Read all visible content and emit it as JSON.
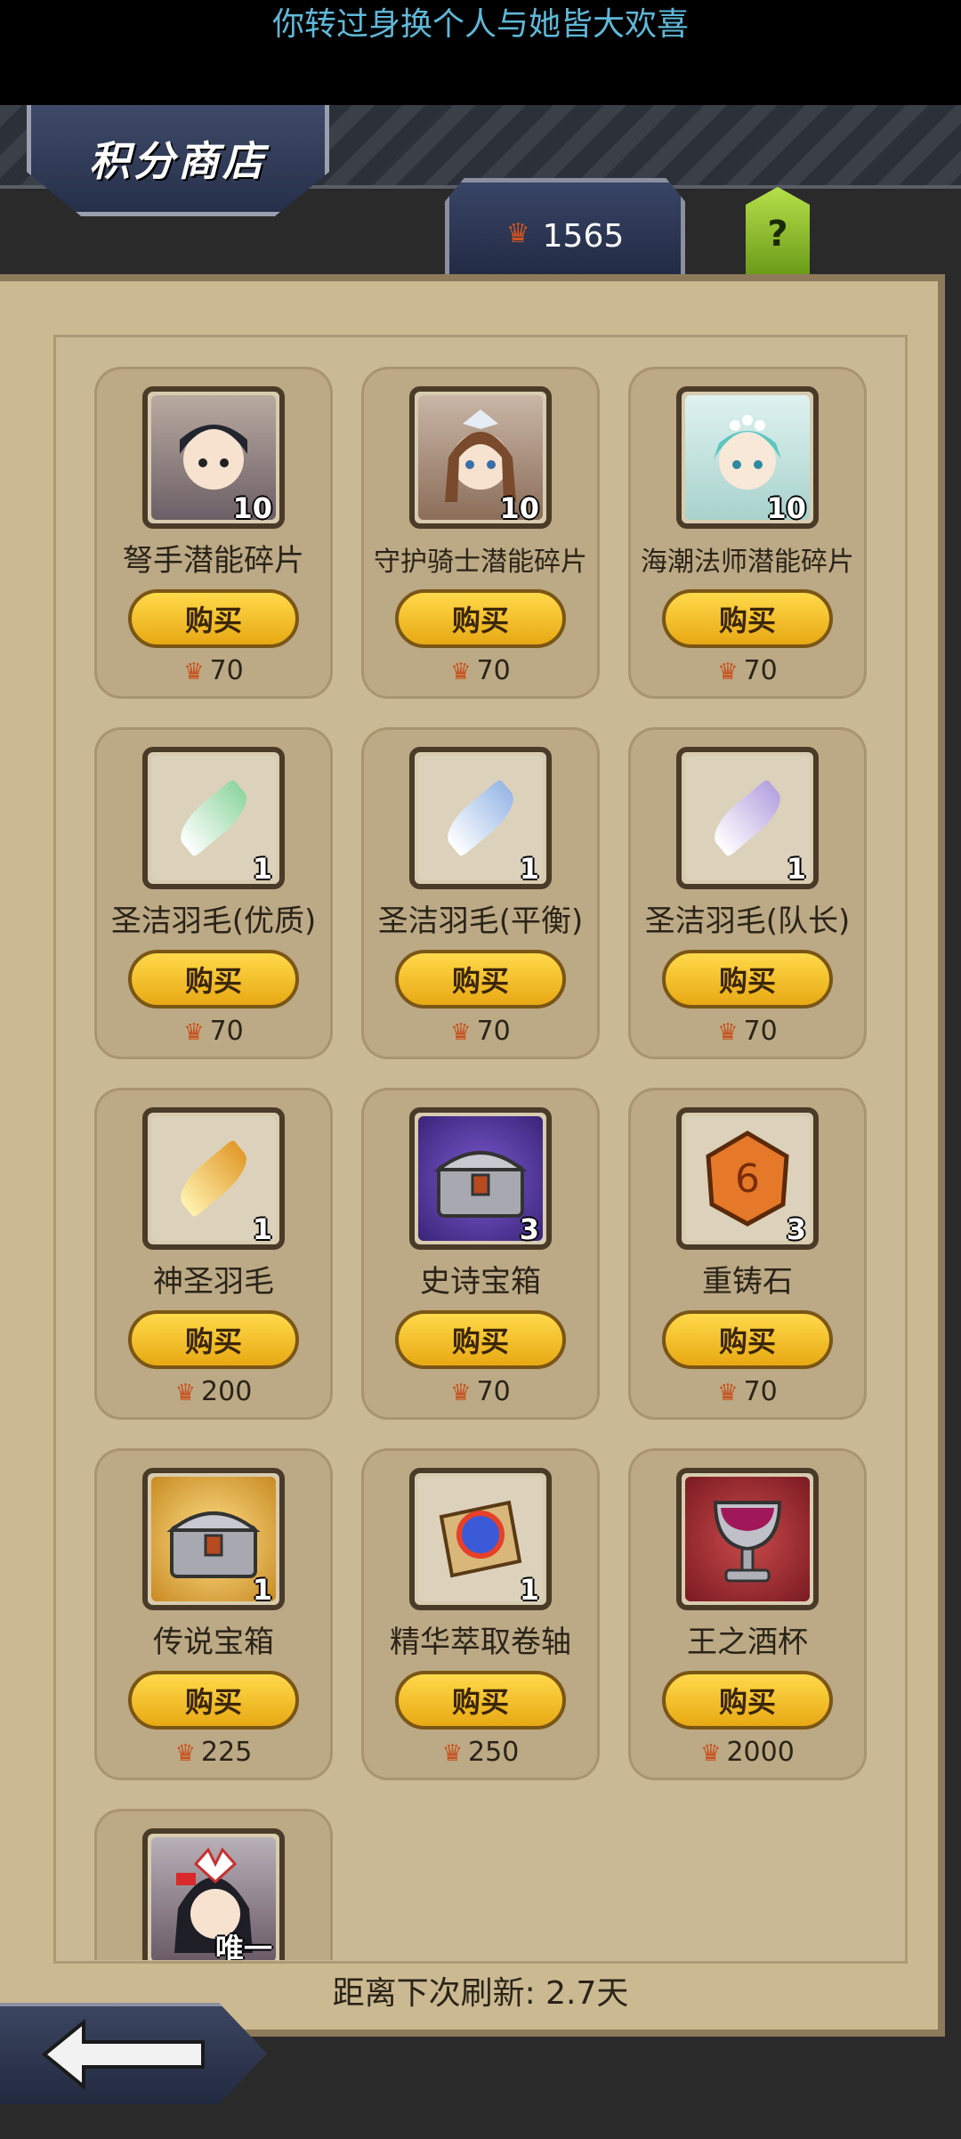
{
  "status_lyric": "你转过身换个人与她皆大欢喜",
  "header": {
    "title": "积分商店",
    "points": "1565",
    "help": "?"
  },
  "buy_label": "购买",
  "items": [
    {
      "name": "弩手潜能碎片",
      "qty": "10",
      "price": "70",
      "icon": "crossbow-girl-portrait-icon"
    },
    {
      "name": "守护骑士潜能碎片",
      "qty": "10",
      "price": "70",
      "icon": "guardian-knight-portrait-icon"
    },
    {
      "name": "海潮法师潜能碎片",
      "qty": "10",
      "price": "70",
      "icon": "tide-mage-portrait-icon"
    },
    {
      "name": "圣洁羽毛(优质)",
      "qty": "1",
      "price": "70",
      "icon": "green-feather-icon"
    },
    {
      "name": "圣洁羽毛(平衡)",
      "qty": "1",
      "price": "70",
      "icon": "blue-feather-icon"
    },
    {
      "name": "圣洁羽毛(队长)",
      "qty": "1",
      "price": "70",
      "icon": "purple-feather-icon"
    },
    {
      "name": "神圣羽毛",
      "qty": "1",
      "price": "200",
      "icon": "golden-feather-icon"
    },
    {
      "name": "史诗宝箱",
      "qty": "3",
      "price": "70",
      "icon": "epic-chest-icon"
    },
    {
      "name": "重铸石",
      "qty": "3",
      "price": "70",
      "icon": "reforge-stone-icon"
    },
    {
      "name": "传说宝箱",
      "qty": "1",
      "price": "225",
      "icon": "legend-chest-icon"
    },
    {
      "name": "精华萃取卷轴",
      "qty": "1",
      "price": "250",
      "icon": "extraction-scroll-icon"
    },
    {
      "name": "王之酒杯",
      "qty": "",
      "price": "2000",
      "icon": "king-goblet-icon"
    },
    {
      "name": "",
      "qty": "唯一",
      "price": "",
      "icon": "fox-mask-girl-portrait-icon"
    }
  ],
  "refresh_text": "距离下次刷新: 2.7天",
  "colors": {
    "accent": "#f3c233",
    "panel": "#cbb992",
    "crown": "#c8501c"
  }
}
